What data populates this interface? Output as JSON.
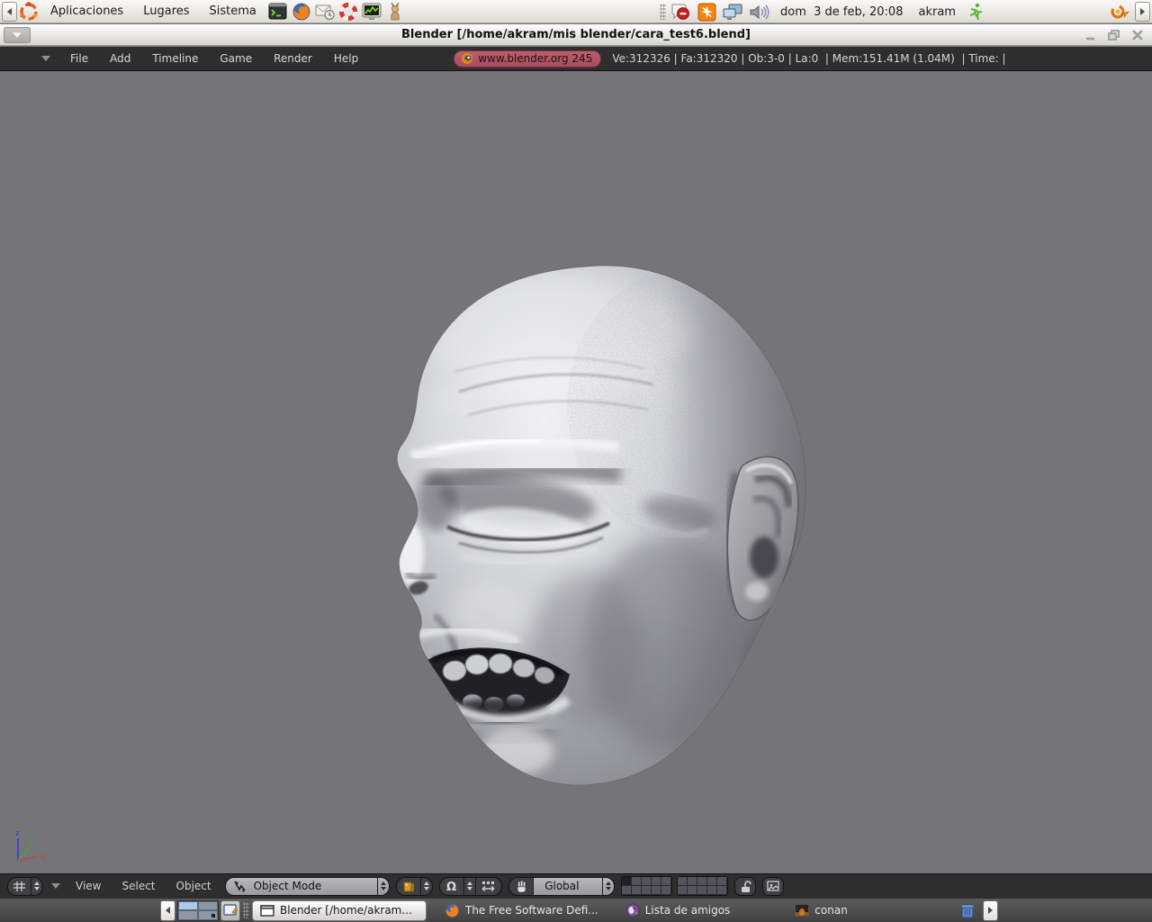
{
  "top_panel": {
    "menus": [
      "Aplicaciones",
      "Lugares",
      "Sistema"
    ],
    "launcher_icons": [
      "terminal-icon",
      "firefox-icon",
      "mail-clock-icon",
      "help-lifesaver-icon",
      "system-monitor-icon",
      "mascot-launcher-icon"
    ],
    "tray_icons": [
      "im-status-busy-icon",
      "notification-star-icon",
      "displays-icon",
      "volume-icon"
    ],
    "clock": "dom  3 de feb, 20:08",
    "user": "akram",
    "corner_icons": [
      "running-man-icon",
      "fusion-icon"
    ]
  },
  "blender": {
    "window_title": "Blender [/home/akram/mis blender/cara_test6.blend]",
    "top_header": {
      "menus": [
        "File",
        "Add",
        "Timeline",
        "Game",
        "Render",
        "Help"
      ],
      "org_badge": "www.blender.org 245",
      "stats": "Ve:312326 | Fa:312320 | Ob:3-0 | La:0  | Mem:151.41M (1.04M)  | Time: |"
    },
    "viewport": {
      "axis": {
        "x": "x",
        "y": "y",
        "z": "z"
      },
      "content": "sculpted bald head model, eyes closed, open smiling mouth with teeth, large right ear"
    },
    "footer": {
      "menus": [
        "View",
        "Select",
        "Object"
      ],
      "mode_selector": "Object Mode",
      "orientation_selector": "Global",
      "layer_count": 20,
      "active_layer": 1,
      "icons": [
        "editor-type-grid-icon",
        "solid-shading-icon",
        "pivot-omega-icon",
        "manipulator-icon",
        "hand-icon",
        "unlock-icon",
        "render-preview-icon"
      ]
    }
  },
  "taskbar": {
    "tasks": [
      {
        "label": "Blender [/home/akram...",
        "icon": "window-icon",
        "active": true
      },
      {
        "label": "The Free Software Defi...",
        "icon": "firefox-icon",
        "active": false
      },
      {
        "label": "Lista de amigos",
        "icon": "pidgin-icon",
        "active": false
      },
      {
        "label": "conan",
        "icon": "image-thumbnail-icon",
        "active": false
      }
    ],
    "other": [
      "workspace-switcher",
      "show-desktop-icon",
      "trash-icon"
    ]
  },
  "colors": {
    "viewport_bg": "#757578",
    "blender_header_bg": "#2e2e2f",
    "badge_bg": "#ae5263",
    "panel_bg": "#e8e5e0",
    "taskbar_bg": "#4e4e4e",
    "workspace_active": "#a9cbea",
    "axis_x": "#cc4040",
    "axis_y": "#3aa83a",
    "axis_z": "#3a3ae0"
  }
}
